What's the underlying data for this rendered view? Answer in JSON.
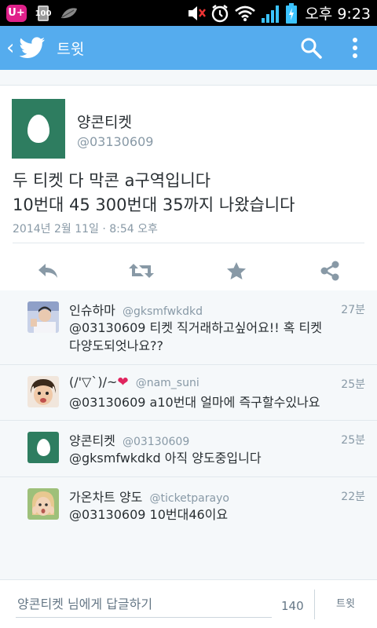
{
  "status_bar": {
    "carrier_badge": "U+",
    "battery_small": "100",
    "time": "오후 9:23",
    "icons": [
      "lg-uplus-icon",
      "battery-saver-icon",
      "leaf-icon",
      "mute-icon",
      "alarm-icon",
      "wifi-icon",
      "signal-icon",
      "battery-icon"
    ]
  },
  "app_bar": {
    "title": "트윗",
    "icons": [
      "back-chevron-icon",
      "twitter-bird-icon",
      "search-icon",
      "overflow-menu-icon"
    ],
    "color": "#55acee"
  },
  "tweet": {
    "name": "양콘티켓",
    "handle": "@03130609",
    "text_line1": "두 티켓 다 막콘 a구역입니다",
    "text_line2": "10번대 45 300번대 35까지 나왔습니다",
    "date": "2014년 2월 11일 · 8:54 오후",
    "actions": [
      "reply-icon",
      "retweet-icon",
      "favorite-icon",
      "share-icon"
    ]
  },
  "replies": [
    {
      "name": "인슈하마",
      "handle": "@gksmfwkdkd",
      "time": "27분",
      "line1": "@03130609 티켓 직거래하고싶어요!! 혹 티켓",
      "line2": "다양도되엇나요??"
    },
    {
      "name": "(/'▽`)/~",
      "heart": "❤",
      "handle": "@nam_suni",
      "time": "25분",
      "line1": "@03130609 a10번대 얼마에 즉구할수있나요"
    },
    {
      "name": "양콘티켓",
      "handle": "@03130609",
      "time": "25분",
      "line1": "@gksmfwkdkd 아직 양도중입니다"
    },
    {
      "name": "가온차트 양도",
      "handle": "@ticketparayo",
      "time": "22분",
      "line1": "@03130609 10번대46이요"
    }
  ],
  "compose": {
    "placeholder": "양콘티켓 님에게 답글하기",
    "count": "140",
    "send_label": "트윗"
  }
}
